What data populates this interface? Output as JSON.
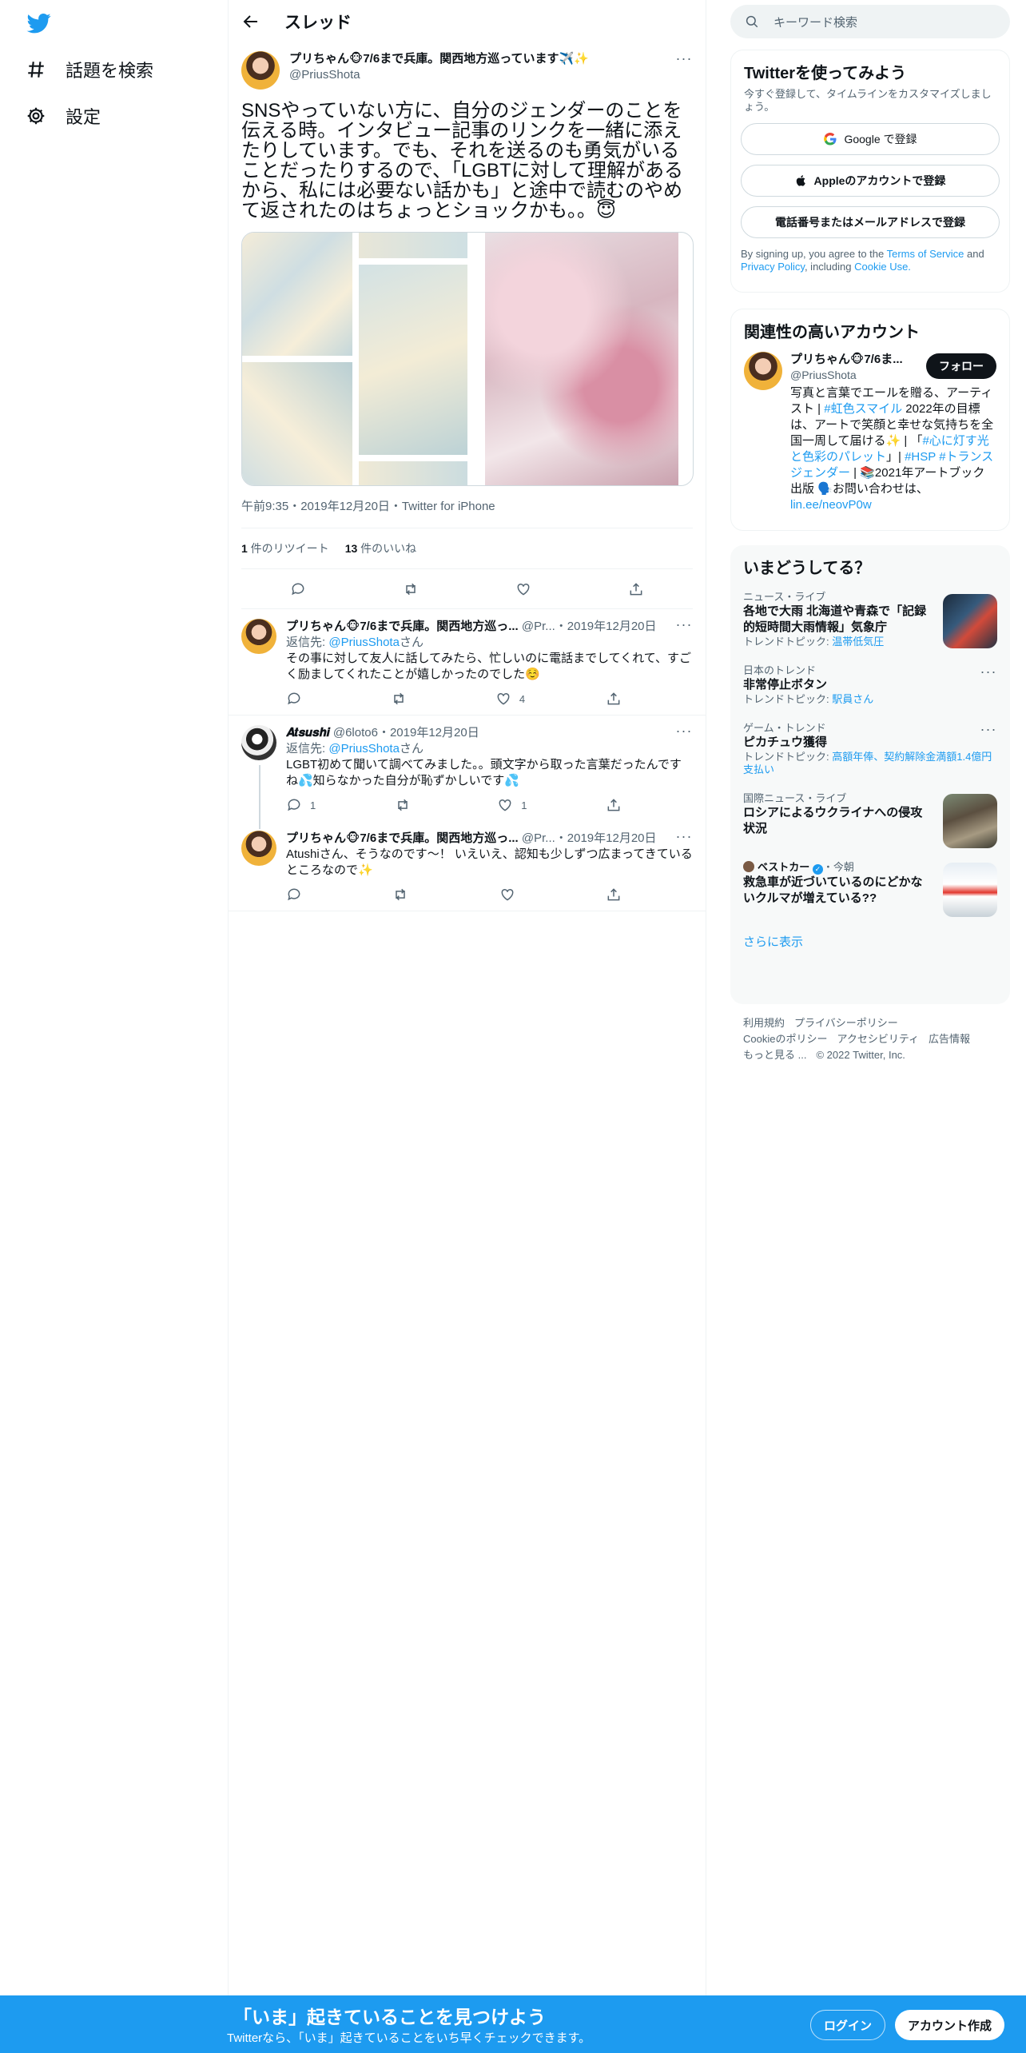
{
  "nav": {
    "explore_label": "話題を検索",
    "settings_label": "設定"
  },
  "header": {
    "title": "スレッド"
  },
  "focus_tweet": {
    "author_name": "プリちゃん🐵7/6まで兵庫。関西地方巡っています✈️✨",
    "author_handle": "@PriusShota",
    "text": "SNSやっていない方に、自分のジェンダーのことを伝える時。インタビュー記事のリンクを一緒に添えたりしています。でも、それを送るのも勇気がいることだったりするので、「LGBTに対して理解があるから、私には必要ない話かも」と途中で読むのやめて返されたのはちょっとショックかも。。😇",
    "timestamp": "午前9:35・2019年12月20日・Twitter for iPhone",
    "retweet_count": "1",
    "retweet_label": " 件のリツイート",
    "like_count": "13",
    "like_label": " 件のいいね"
  },
  "replies": [
    {
      "name": "プリちゃん🐵7/6まで兵庫。関西地方巡っ...",
      "handle": "@Pr...",
      "date": "・2019年12月20日",
      "reply_prefix": "返信先: ",
      "reply_to": "@PriusShota",
      "reply_suffix": "さん",
      "text": "その事に対して友人に話してみたら、忙しいのに電話までしてくれて、すごく励ましてくれたことが嬉しかったのでした☺️",
      "reply_count": "",
      "retweet_count": "",
      "like_count": "4"
    },
    {
      "name": "𝑨𝒕𝒔𝒖𝒔𝒉𝒊",
      "handle": "@6loto6",
      "date": "・2019年12月20日",
      "reply_prefix": "返信先: ",
      "reply_to": "@PriusShota",
      "reply_suffix": "さん",
      "text": "LGBT初めて聞いて調べてみました。。頭文字から取った言葉だったんですね💦知らなかった自分が恥ずかしいです💦",
      "reply_count": "1",
      "retweet_count": "",
      "like_count": "1"
    },
    {
      "name": "プリちゃん🐵7/6まで兵庫。関西地方巡っ...",
      "handle": "@Pr...",
      "date": "・2019年12月20日",
      "text": "Atushiさん、そうなのです〜！ いえいえ、認知も少しずつ広まってきているところなので✨",
      "reply_count": "",
      "retweet_count": "",
      "like_count": ""
    }
  ],
  "search": {
    "placeholder": "キーワード検索"
  },
  "signup_card": {
    "title": "Twitterを使ってみよう",
    "subtitle": "今すぐ登録して、タイムラインをカスタマイズしましょう。",
    "google": "Google で登録",
    "apple": "Appleのアカウントで登録",
    "phone": "電話番号またはメールアドレスで登録",
    "terms_prefix": "By signing up, you agree to the ",
    "terms_link": "Terms of Service",
    "terms_and": " and ",
    "privacy_link": "Privacy Policy",
    "including": ", including ",
    "cookie_link": "Cookie Use."
  },
  "related": {
    "title": "関連性の高いアカウント",
    "name": "プリちゃん🐵7/6ま...",
    "handle": "@PriusShota",
    "follow": "フォロー",
    "bio_1": "写真と言葉でエールを贈る、アーティスト | ",
    "bio_tag1": "#虹色スマイル",
    "bio_2": " 2022年の目標は、アートで笑顔と幸せな気持ちを全国一周して届ける✨ | 「",
    "bio_tag2": "#心に灯す光と色彩のパレット",
    "bio_3": "」| ",
    "bio_tag3": "#HSP",
    "bio_sp": " ",
    "bio_tag4": "#トランスジェンダー",
    "bio_4": " | 📚2021年アートブック出版 🗣️お問い合わせは、",
    "bio_link": "lin.ee/neovP0w"
  },
  "trends": {
    "title": "いまどうしてる？",
    "items": [
      {
        "category": "ニュース・ライブ",
        "title": "各地で大雨 北海道や青森で「記録的短時間大雨情報」気象庁",
        "extra_prefix": "トレンドトピック: ",
        "extra_link": "温帯低気圧"
      },
      {
        "category": "日本のトレンド",
        "title": "非常停止ボタン",
        "extra_prefix": "トレンドトピック: ",
        "extra_link": "駅員さん"
      },
      {
        "category": "ゲーム・トレンド",
        "title": "ピカチュウ獲得",
        "extra_prefix": "トレンドトピック: ",
        "extra_link": "高額年俸、契約解除金満額1.4億円支払い"
      },
      {
        "category": "国際ニュース・ライブ",
        "title": "ロシアによるウクライナへの侵攻状況"
      },
      {
        "category": "ベストカー",
        "category_suffix": "・今朝",
        "title": "救急車が近づいているのにどかないクルマが増えている??"
      }
    ],
    "show_more": "さらに表示"
  },
  "footer": {
    "terms": "利用規約",
    "privacy": "プライバシーポリシー",
    "cookie": "Cookieのポリシー",
    "accessibility": "アクセシビリティ",
    "ads": "広告情報",
    "more": "もっと見る ...",
    "copyright": "© 2022 Twitter, Inc."
  },
  "banner": {
    "title": "「いま」起きていることを見つけよう",
    "subtitle": "Twitterなら、「いま」起きていることをいち早くチェックできます。",
    "login": "ログイン",
    "signup": "アカウント作成"
  },
  "colors": {
    "brand": "#1d9bf0",
    "text": "#0f1419",
    "muted": "#536471",
    "border": "#eff3f4"
  }
}
